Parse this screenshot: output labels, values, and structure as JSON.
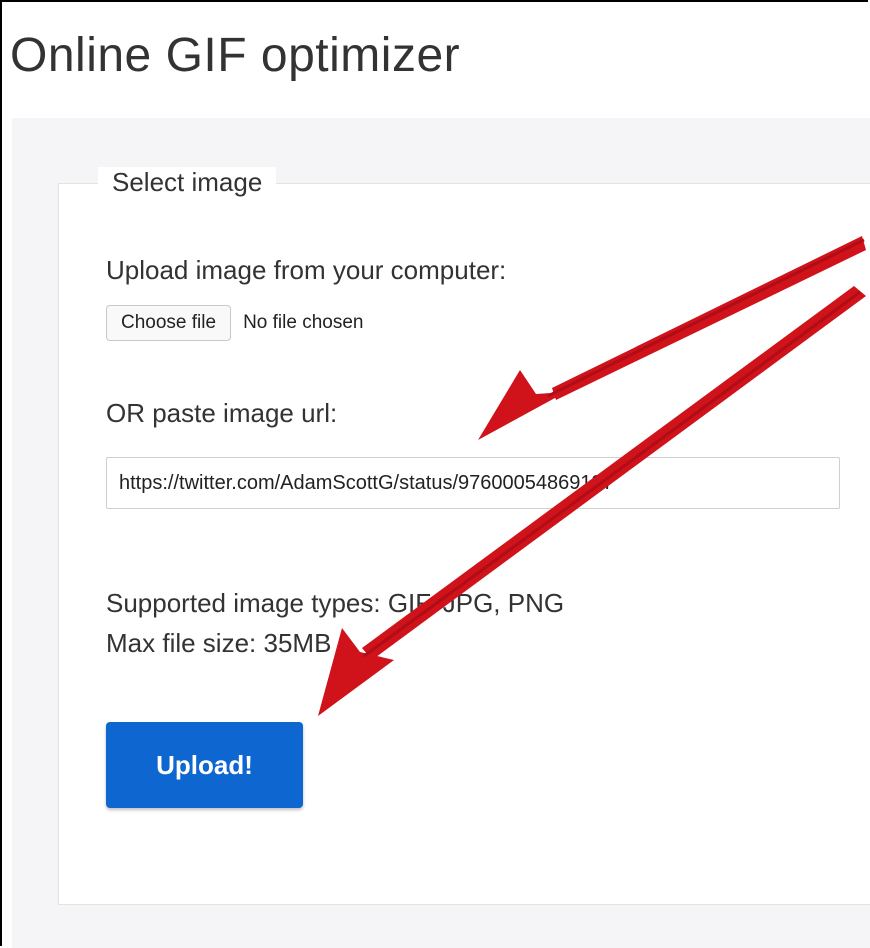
{
  "page_title": "Online GIF optimizer",
  "form": {
    "legend": "Select image",
    "upload_label": "Upload image from your computer:",
    "choose_file_button": "Choose file",
    "no_file_text": "No file chosen",
    "url_label": "OR paste image url:",
    "url_value": "https://twitter.com/AdamScottG/status/97600054869137",
    "supported_types": "Supported image types: GIF, JPG, PNG",
    "max_size": "Max file size: 35MB",
    "upload_button": "Upload!"
  },
  "colors": {
    "primary_button": "#0e66d0",
    "annotation_arrow": "#d0121b",
    "content_background": "#f5f5f7"
  }
}
